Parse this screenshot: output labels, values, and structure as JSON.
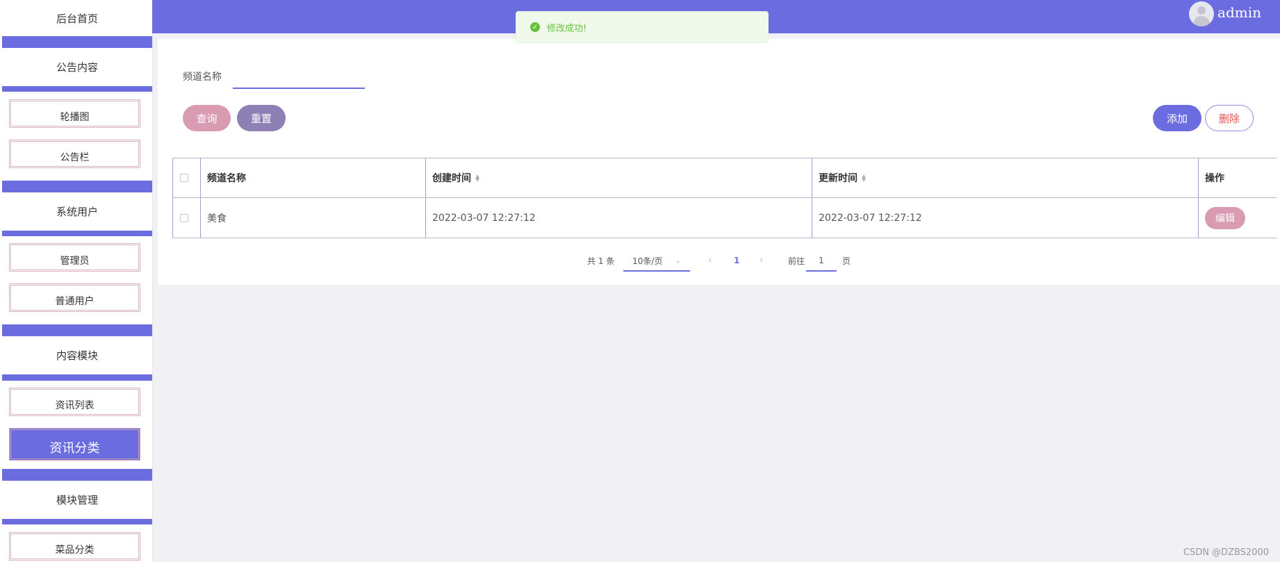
{
  "sidebar": {
    "titles": [
      "后台首页",
      "公告内容",
      "系统用户",
      "内容模块",
      "模块管理"
    ],
    "items": [
      "轮播图",
      "公告栏",
      "管理员",
      "普通用户",
      "资讯列表",
      "资讯分类",
      "菜品分类"
    ],
    "active_item": "资讯分类"
  },
  "header": {
    "username": "admin"
  },
  "toast": {
    "message": "修改成功!"
  },
  "search": {
    "label": "频道名称",
    "value": ""
  },
  "buttons": {
    "query": "查询",
    "reset": "重置",
    "add": "添加",
    "delete": "删除",
    "edit": "编辑"
  },
  "table": {
    "columns": [
      "频道名称",
      "创建时间",
      "更新时间",
      "操作"
    ],
    "rows": [
      {
        "name": "美食",
        "created": "2022-03-07 12:27:12",
        "updated": "2022-03-07 12:27:12"
      }
    ]
  },
  "pagination": {
    "total_text": "共 1 条",
    "page_size": "10条/页",
    "current_page": "1",
    "goto_label": "前往",
    "goto_value": "1",
    "page_unit": "页"
  },
  "watermark": "CSDN @DZBS2000",
  "colors": {
    "primary": "#6a6cdf",
    "pink": "#d99bb1",
    "purple": "#8e7fb5",
    "success": "#67c23a"
  }
}
